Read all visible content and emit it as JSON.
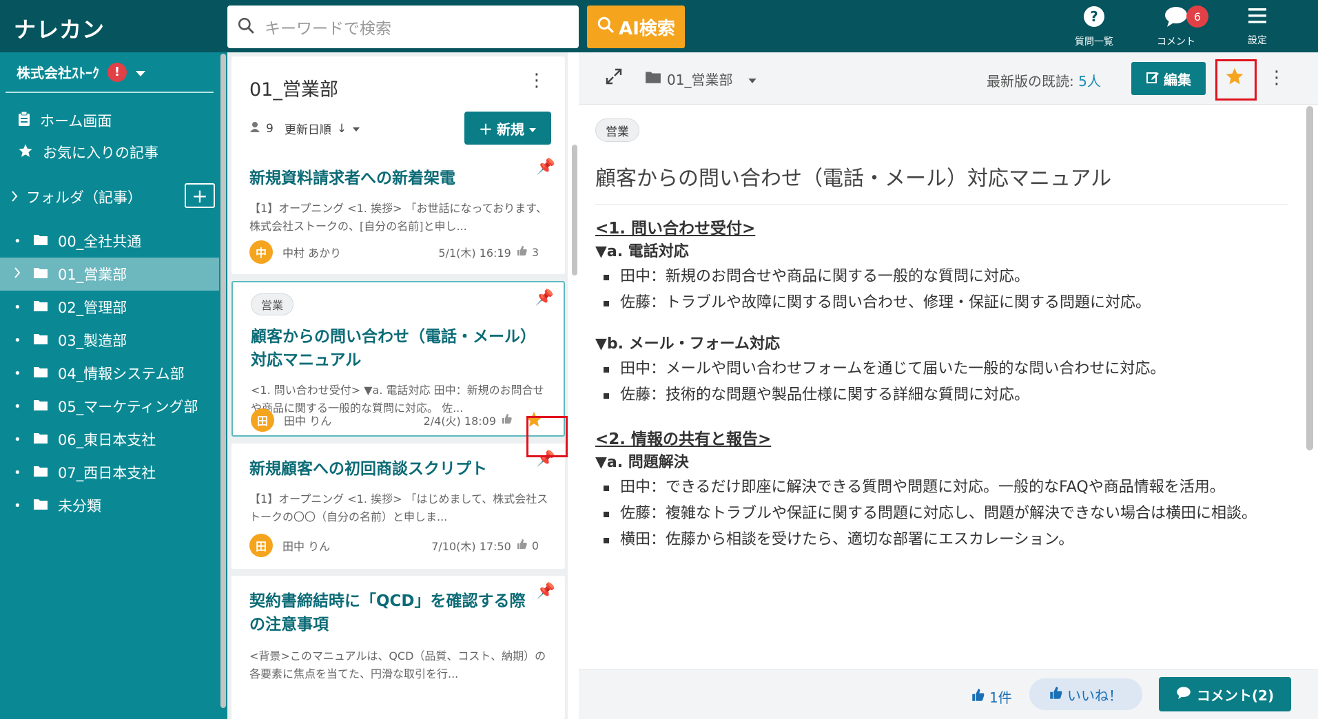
{
  "app": {
    "logo": "ナレカン"
  },
  "search": {
    "placeholder": "キーワードで検索",
    "ai_button": "AI検索"
  },
  "header_icons": {
    "questions": "質問一覧",
    "comments": "コメント",
    "comments_badge": "6",
    "settings": "設定"
  },
  "sidebar": {
    "company": "株式会社ｽﾄｰｸ",
    "alert": "!",
    "home": "ホーム画面",
    "favorites": "お気に入りの記事",
    "folder_header": "フォルダ（記事）",
    "folders": [
      {
        "label": "00_全社共通"
      },
      {
        "label": "01_営業部"
      },
      {
        "label": "02_管理部"
      },
      {
        "label": "03_製造部"
      },
      {
        "label": "04_情報システム部"
      },
      {
        "label": "05_マーケティング部"
      },
      {
        "label": "06_東日本支社"
      },
      {
        "label": "07_西日本支社"
      },
      {
        "label": "未分類"
      }
    ]
  },
  "list": {
    "title": "01_営業部",
    "member_count": "9",
    "sort_label": "更新日順",
    "new_button": "新規",
    "cards": [
      {
        "title": "新規資料請求者への新着架電",
        "excerpt": "【1】オープニング <1. 挨拶> 「お世話になっております、株式会社ストークの、[自分の名前]と申し...",
        "avatar": "中",
        "author": "中村 あかり",
        "date": "5/1(木) 16:19",
        "likes": "3"
      },
      {
        "tag": "営業",
        "title": "顧客からの問い合わせ（電話・メール）対応マニュアル",
        "excerpt": "<1. 問い合わせ受付> ▼a. 電話対応 田中：新規のお問合せや商品に関する一般的な質問に対応。 佐...",
        "avatar": "田",
        "author": "田中 りん",
        "date": "2/4(火) 18:09"
      },
      {
        "title": "新規顧客への初回商談スクリプト",
        "excerpt": "【1】オープニング <1. 挨拶> 「はじめまして、株式会社ストークの〇〇（自分の名前）と申しま...",
        "avatar": "田",
        "author": "田中 りん",
        "date": "7/10(木) 17:50",
        "likes": "0"
      },
      {
        "title": "契約書締結時に「QCD」を確認する際の注意事項",
        "excerpt": "<背景>このマニュアルは、QCD（品質、コスト、納期）の各要素に焦点を当てた、円滑な取引を行..."
      }
    ]
  },
  "detail": {
    "breadcrumb": "01_営業部",
    "readers_label": "最新版の既読:",
    "readers_count": "5人",
    "edit_button": "編集",
    "tag": "営業",
    "title": "顧客からの問い合わせ（電話・メール）対応マニュアル",
    "sections": {
      "s1": "<1. 問い合わせ受付>",
      "s1a": "▼a. 電話対応",
      "s1a_items": [
        "田中：新規のお問合せや商品に関する一般的な質問に対応。",
        "佐藤：トラブルや故障に関する問い合わせ、修理・保証に関する問題に対応。"
      ],
      "s1b": "▼b. メール・フォーム対応",
      "s1b_items": [
        "田中：メールや問い合わせフォームを通じて届いた一般的な問い合わせに対応。",
        "佐藤：技術的な問題や製品仕様に関する詳細な質問に対応。"
      ],
      "s2": "<2. 情報の共有と報告>",
      "s2a": "▼a. 問題解決",
      "s2a_items": [
        "田中：できるだけ即座に解決できる質問や問題に対応。一般的なFAQや商品情報を活用。",
        "佐藤：複雑なトラブルや保証に関する問題に対応し、問題が解決できない場合は横田に相談。",
        "横田：佐藤から相談を受けたら、適切な部署にエスカレーション。"
      ]
    },
    "footer": {
      "like_count": "1件",
      "like_button": "いいね！",
      "comment_button": "コメント(2)"
    }
  },
  "colors": {
    "header": "#05545e",
    "sidebar": "#0a8994",
    "accent": "#0a7d87",
    "ai_button": "#f5a41e",
    "star": "#f5a41e",
    "highlight": "#e0121d"
  }
}
